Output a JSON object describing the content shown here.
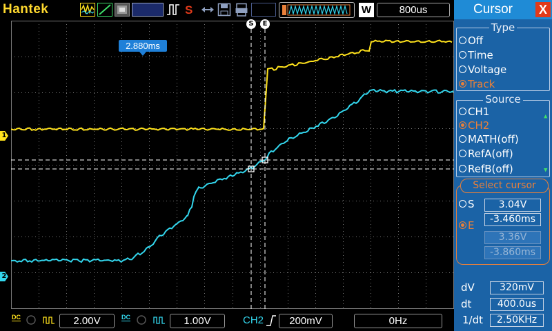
{
  "brand": "Hantek",
  "top_bar": {
    "timebase": "800us",
    "memory_depth_label": "W",
    "trigger_position": "2.880ms",
    "icons": [
      "waveform-icon",
      "trigger-slope-icon",
      "persistence-icon",
      "pulse-icon",
      "stop-s-icon",
      "cursor-arrows-icon",
      "save-disk-icon",
      "print-icon"
    ]
  },
  "screen": {
    "ch1_marker": "1",
    "ch2_marker": "2",
    "cursor_s_label": "S",
    "cursor_e_label": "E"
  },
  "bottom_bar": {
    "ch1_coupling": "DC",
    "ch1_scale": "2.00V",
    "ch2_coupling": "DC",
    "ch2_scale": "1.00V",
    "trigger_source": "CH2",
    "trigger_level": "200mV",
    "frequency": "0Hz"
  },
  "panel": {
    "title": "Cursor",
    "close_label": "X",
    "type": {
      "label": "Type",
      "options": [
        "Off",
        "Time",
        "Voltage",
        "Track"
      ],
      "selected": "Track"
    },
    "source": {
      "label": "Source",
      "options": [
        "CH1",
        "CH2",
        "MATH(off)",
        "RefA(off)",
        "RefB(off)"
      ],
      "selected": "CH2"
    },
    "select_cursor": {
      "label": "Select cursor",
      "s_label": "S",
      "e_label": "E",
      "s_voltage": "3.04V",
      "s_time": "-3.460ms",
      "e_voltage": "3.36V",
      "e_time": "-3.860ms",
      "selected": "E"
    },
    "measurements": {
      "dv_label": "dV",
      "dv_value": "320mV",
      "dt_label": "dt",
      "dt_value": "400.0us",
      "inv_dt_label": "1/dt",
      "inv_dt_value": "2.50KHz"
    }
  },
  "colors": {
    "ch1": "#ffe21c",
    "ch2": "#33d7ee",
    "panel_bg": "#1b63a6",
    "accent": "#e8803a",
    "grid": "#7a7a7a"
  }
}
